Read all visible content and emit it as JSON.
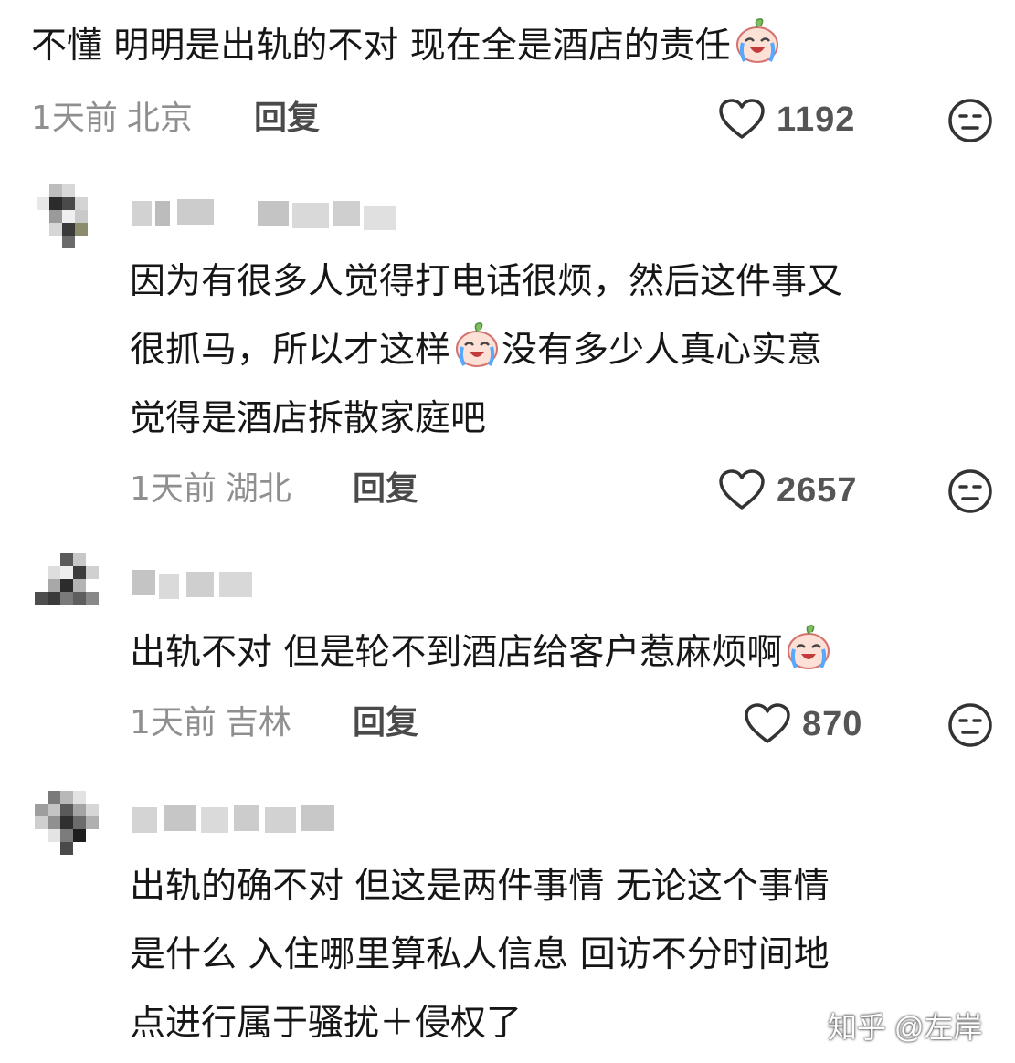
{
  "comments": [
    {
      "text": "不懂 明明是出轨的不对 现在全是酒店的责任",
      "time": "1天前",
      "location": "北京",
      "reply_label": "回复",
      "likes": "1192",
      "emoji": "crying-laughing-face"
    },
    {
      "lines": [
        "因为有很多人觉得打电话很烦，然后这件事又",
        "很抓马，所以才这样",
        "没有多少人真心实意",
        "觉得是酒店拆散家庭吧"
      ],
      "time": "1天前",
      "location": "湖北",
      "reply_label": "回复",
      "likes": "2657",
      "emoji": "crying-laughing-face"
    },
    {
      "text": "出轨不对 但是轮不到酒店给客户惹麻烦啊",
      "time": "1天前",
      "location": "吉林",
      "reply_label": "回复",
      "likes": "870",
      "emoji": "crying-laughing-face"
    },
    {
      "lines": [
        "出轨的确不对 但这是两件事情 无论这个事情",
        "是什么 入住哪里算私人信息 回访不分时间地",
        "点进行属于骚扰＋侵权了"
      ]
    }
  ],
  "watermark": "知乎 @左岸",
  "colors": {
    "text": "#161616",
    "meta": "#8f8f8f",
    "icon": "#333333"
  },
  "icons": [
    "heart-outline-icon",
    "meh-face-icon",
    "crying-laughing-emoji"
  ]
}
